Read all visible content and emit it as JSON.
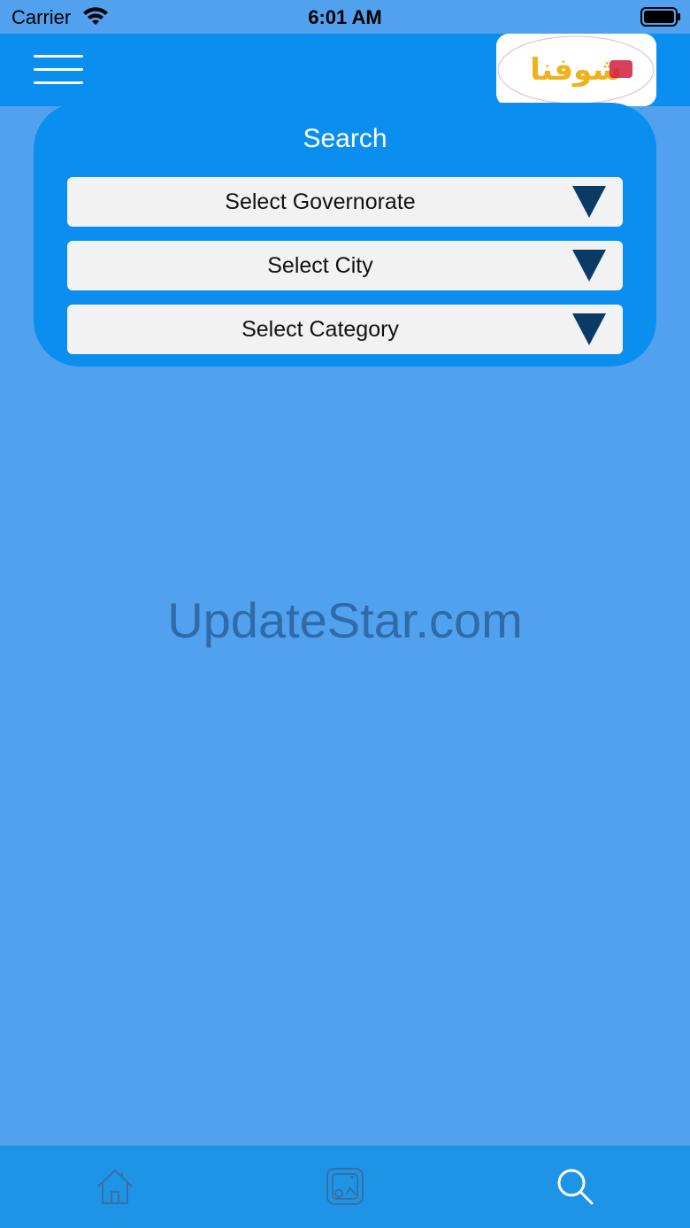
{
  "status_bar": {
    "carrier": "Carrier",
    "time": "6:01 AM"
  },
  "nav": {
    "logo_text": "شوفنا"
  },
  "search": {
    "title": "Search",
    "dropdowns": [
      {
        "label": "Select Governorate"
      },
      {
        "label": "Select City"
      },
      {
        "label": "Select Category"
      }
    ]
  },
  "watermark": "UpdateStar.com",
  "tabs": [
    {
      "icon": "home-icon",
      "active": false
    },
    {
      "icon": "gallery-icon",
      "active": false
    },
    {
      "icon": "search-icon",
      "active": true
    }
  ],
  "colors": {
    "background": "#51a1ee",
    "nav": "#0a8ff0",
    "tab_bar": "#1e94e6",
    "dropdown_arrow": "#0a3a66",
    "logo_text": "#f0b21b",
    "logo_accent": "#d11d3d"
  }
}
